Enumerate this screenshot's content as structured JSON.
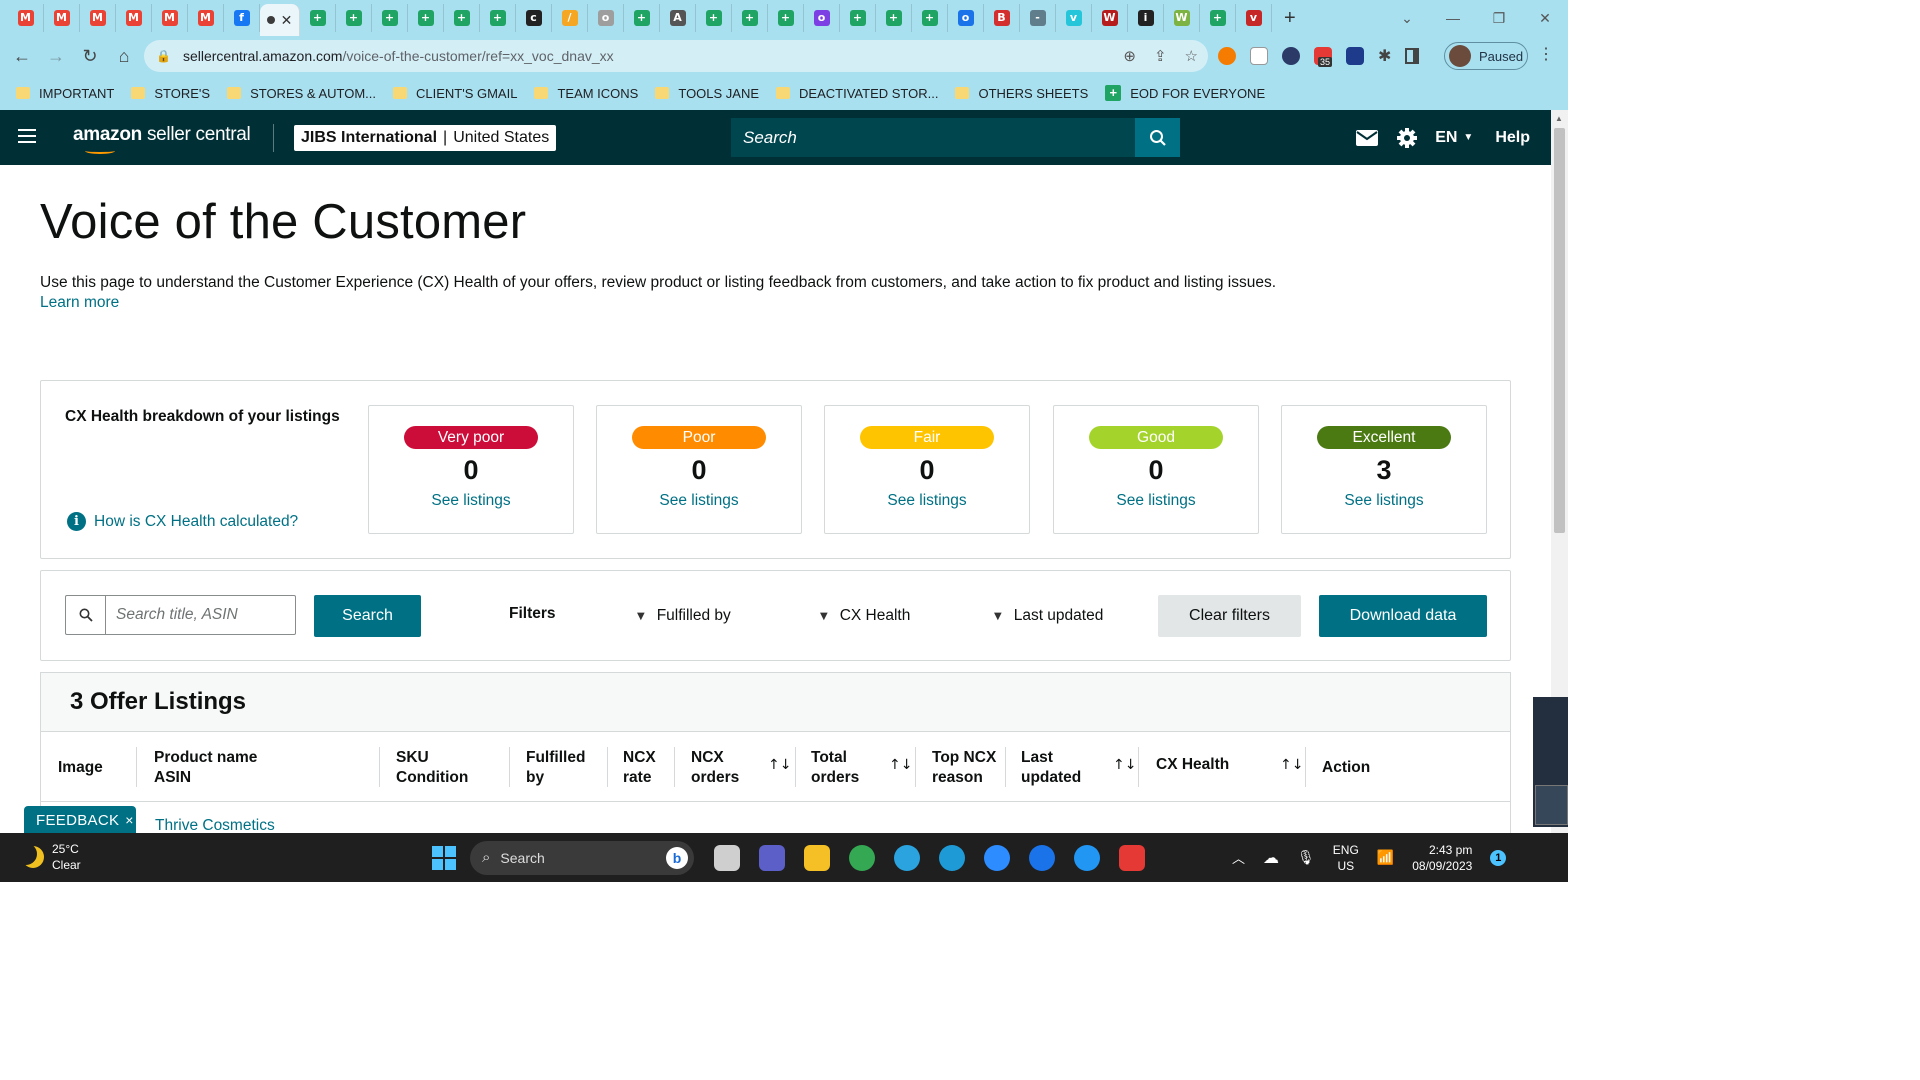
{
  "browser": {
    "tabs": [
      {
        "icon": "gmail-icon",
        "color": "#ea4335",
        "glyph": "M"
      },
      {
        "icon": "gmail-icon",
        "color": "#ea4335",
        "glyph": "M"
      },
      {
        "icon": "gmail-icon",
        "color": "#ea4335",
        "glyph": "M"
      },
      {
        "icon": "gmail-icon",
        "color": "#ea4335",
        "glyph": "M"
      },
      {
        "icon": "gmail-icon",
        "color": "#ea4335",
        "glyph": "M"
      },
      {
        "icon": "gmail-icon",
        "color": "#ea4335",
        "glyph": "M"
      },
      {
        "icon": "facebook-icon",
        "color": "#1877f2",
        "glyph": "f"
      },
      {
        "icon": "active-tab-icon",
        "color": "#ffffff",
        "glyph": "",
        "active": true
      },
      {
        "icon": "sheets-icon",
        "color": "#1fa463",
        "glyph": "+"
      },
      {
        "icon": "sheets-icon",
        "color": "#1fa463",
        "glyph": "+"
      },
      {
        "icon": "sheets-icon",
        "color": "#1fa463",
        "glyph": "+"
      },
      {
        "icon": "sheets-icon",
        "color": "#1fa463",
        "glyph": "+"
      },
      {
        "icon": "sheets-icon",
        "color": "#1fa463",
        "glyph": "+"
      },
      {
        "icon": "sheets-icon",
        "color": "#1fa463",
        "glyph": "+"
      },
      {
        "icon": "app-icon",
        "color": "#222222",
        "glyph": "c"
      },
      {
        "icon": "app-icon",
        "color": "#f5a623",
        "glyph": "/"
      },
      {
        "icon": "app-icon",
        "color": "#9e9e9e",
        "glyph": "o"
      },
      {
        "icon": "sheets-icon",
        "color": "#1fa463",
        "glyph": "+"
      },
      {
        "icon": "app-icon",
        "color": "#555555",
        "glyph": "A"
      },
      {
        "icon": "sheets-icon",
        "color": "#1fa463",
        "glyph": "+"
      },
      {
        "icon": "sheets-icon",
        "color": "#1fa463",
        "glyph": "+"
      },
      {
        "icon": "sheets-icon",
        "color": "#1fa463",
        "glyph": "+"
      },
      {
        "icon": "app-icon",
        "color": "#7b3fe4",
        "glyph": "o"
      },
      {
        "icon": "sheets-icon",
        "color": "#1fa463",
        "glyph": "+"
      },
      {
        "icon": "sheets-icon",
        "color": "#1fa463",
        "glyph": "+"
      },
      {
        "icon": "sheets-icon",
        "color": "#1fa463",
        "glyph": "+"
      },
      {
        "icon": "app-icon",
        "color": "#1a73e8",
        "glyph": "o"
      },
      {
        "icon": "app-icon",
        "color": "#d32f2f",
        "glyph": "B"
      },
      {
        "icon": "app-icon",
        "color": "#607d8b",
        "glyph": "-"
      },
      {
        "icon": "app-icon",
        "color": "#26c6da",
        "glyph": "v"
      },
      {
        "icon": "app-icon",
        "color": "#b71c1c",
        "glyph": "W"
      },
      {
        "icon": "app-icon",
        "color": "#222222",
        "glyph": "i"
      },
      {
        "icon": "app-icon",
        "color": "#7cb342",
        "glyph": "W"
      },
      {
        "icon": "sheets-icon",
        "color": "#1fa463",
        "glyph": "+"
      },
      {
        "icon": "app-icon",
        "color": "#c62828",
        "glyph": "v"
      }
    ],
    "new_tab_glyph": "+",
    "url_host": "sellercentral.amazon.com",
    "url_path": "/voice-of-the-customer/ref=xx_voc_dnav_xx",
    "profile_status": "Paused",
    "extension_badge": "35",
    "bookmarks": [
      {
        "label": "IMPORTANT",
        "type": "folder"
      },
      {
        "label": "STORE'S",
        "type": "folder"
      },
      {
        "label": "STORES & AUTOM...",
        "type": "folder"
      },
      {
        "label": "CLIENT'S GMAIL",
        "type": "folder"
      },
      {
        "label": "TEAM ICONS",
        "type": "folder"
      },
      {
        "label": "TOOLS JANE",
        "type": "folder"
      },
      {
        "label": "DEACTIVATED STOR...",
        "type": "folder"
      },
      {
        "label": "OTHERS SHEETS",
        "type": "folder"
      },
      {
        "label": "EOD FOR EVERYONE",
        "type": "sheet"
      }
    ]
  },
  "header": {
    "logo_brand": "amazon",
    "logo_product": "seller central",
    "account_name": "JIBS International",
    "account_sep": "|",
    "account_region": "United States",
    "search_placeholder": "Search",
    "language": "EN",
    "help": "Help"
  },
  "page": {
    "title": "Voice of the Customer",
    "description": "Use this page to understand the Customer Experience (CX) Health of your offers, review product or listing feedback from customers, and take action to fix product and listing issues.",
    "learn_more": "Learn more"
  },
  "cx": {
    "title": "CX Health breakdown of your listings",
    "how_link": "How is CX Health calculated?",
    "tiles": [
      {
        "label": "Very poor",
        "count": "0",
        "link": "See listings",
        "color": "#cc0c39",
        "text_color": "#ffffff"
      },
      {
        "label": "Poor",
        "count": "0",
        "link": "See listings",
        "color": "#ff8c00",
        "text_color": "#ffffff"
      },
      {
        "label": "Fair",
        "count": "0",
        "link": "See listings",
        "color": "#ffc400",
        "text_color": "#ffffff"
      },
      {
        "label": "Good",
        "count": "0",
        "link": "See listings",
        "color": "#a4d42c",
        "text_color": "#ffffff"
      },
      {
        "label": "Excellent",
        "count": "3",
        "link": "See listings",
        "color": "#4b7a12",
        "text_color": "#ffffff"
      }
    ]
  },
  "filters": {
    "search_placeholder": "Search title, ASIN",
    "search_button": "Search",
    "filters_label": "Filters",
    "fulfilled_by": "Fulfilled by",
    "cx_health": "CX Health",
    "last_updated": "Last updated",
    "clear": "Clear filters",
    "download": "Download data"
  },
  "listings": {
    "title": "3 Offer Listings",
    "columns": {
      "image": "Image",
      "product_l1": "Product name",
      "product_l2": "ASIN",
      "sku_l1": "SKU",
      "sku_l2": "Condition",
      "fulfilled_l1": "Fulfilled",
      "fulfilled_l2": "by",
      "ncx_rate_l1": "NCX",
      "ncx_rate_l2": "rate",
      "ncx_orders_l1": "NCX",
      "ncx_orders_l2": "orders",
      "total_l1": "Total",
      "total_l2": "orders",
      "top_l1": "Top NCX",
      "top_l2": "reason",
      "last_l1": "Last",
      "last_l2": "updated",
      "cx_health": "CX Health",
      "action": "Action"
    },
    "sort_glyph": "↑↓",
    "first_row_product": "Thrive Cosmetics"
  },
  "feedback": {
    "label": "FEEDBACK",
    "close": "×"
  },
  "taskbar": {
    "temperature": "25°C",
    "condition": "Clear",
    "search": "Search",
    "bing": "b",
    "lang1": "ENG",
    "lang2": "US",
    "time": "2:43 pm",
    "date": "08/09/2023",
    "notif_count": "1",
    "apps": [
      {
        "icon": "task-view-icon",
        "color": "#cfcfcf"
      },
      {
        "icon": "teams-icon",
        "color": "#5b5fc7"
      },
      {
        "icon": "file-explorer-icon",
        "color": "#f4c025"
      },
      {
        "icon": "chrome-icon",
        "color": "#34a853"
      },
      {
        "icon": "telegram-icon",
        "color": "#2aa3df"
      },
      {
        "icon": "edge-icon",
        "color": "#1e9bd7"
      },
      {
        "icon": "zoom-icon",
        "color": "#2d8cff"
      },
      {
        "icon": "maps-icon",
        "color": "#1a73e8"
      },
      {
        "icon": "globe-icon",
        "color": "#2196f3"
      },
      {
        "icon": "wps-icon",
        "color": "#e53935"
      }
    ]
  }
}
